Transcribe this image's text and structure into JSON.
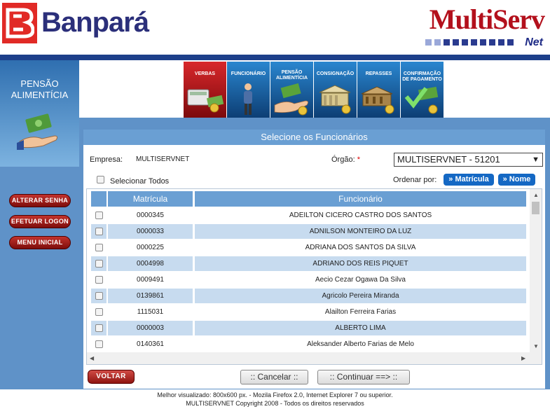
{
  "brand": {
    "bank": "Banpará",
    "app_title": "MultiServ",
    "app_suffix": "Net"
  },
  "left_panel": {
    "title_line1": "PENSÃO",
    "title_line2": "ALIMENTÍCIA",
    "buttons": [
      "ALTERAR SENHA",
      "EFETUAR LOGON",
      "MENU INICIAL"
    ]
  },
  "nav": [
    {
      "label": "VERBAS",
      "color": "#c0161b"
    },
    {
      "label": "FUNCIONÁRIO",
      "color": "#1f6aa8"
    },
    {
      "label": "PENSÃO ALIMENTÍCIA",
      "color": "#1f6aa8"
    },
    {
      "label": "CONSIGNAÇÃO",
      "color": "#1f6aa8"
    },
    {
      "label": "REPASSES",
      "color": "#1f6aa8"
    },
    {
      "label": "CONFIRMAÇÃO DE PAGAMENTO",
      "color": "#1f6aa8"
    }
  ],
  "panel": {
    "title": "Selecione os Funcionários",
    "empresa_label": "Empresa:",
    "empresa_value": "MULTISERVNET",
    "orgao_label": "Órgão:",
    "orgao_required": "*",
    "orgao_value": "MULTISERVNET - 51201",
    "select_all": "Selecionar Todos",
    "order_label": "Ordenar por:",
    "order_matricula": "» Matrícula",
    "order_nome": "» Nome"
  },
  "table": {
    "columns": [
      "Matrícula",
      "Funcionário"
    ],
    "rows": [
      [
        "0000345",
        "ADEILTON CICERO CASTRO DOS SANTOS"
      ],
      [
        "0000033",
        "ADNILSON MONTEIRO DA LUZ"
      ],
      [
        "0000225",
        "ADRIANA DOS SANTOS DA SILVA"
      ],
      [
        "0004998",
        "ADRIANO DOS REIS PIQUET"
      ],
      [
        "0009491",
        "Aecio Cezar Ogawa Da Silva"
      ],
      [
        "0139861",
        "Agricolo Pereira Miranda"
      ],
      [
        "1115031",
        "Alailton Ferreira Farias"
      ],
      [
        "0000003",
        "ALBERTO LIMA"
      ],
      [
        "0140361",
        "Aleksander Alberto Farias de Melo"
      ]
    ]
  },
  "actions": {
    "voltar": "VOLTAR",
    "cancelar": ":: Cancelar ::",
    "continuar": ":: Continuar ==> ::"
  },
  "footer": {
    "line1": "Melhor visualizado: 800x600 px. - Mozila Firefox 2.0, Internet Explorer 7 ou superior.",
    "line2": "MULTISERVNET Copyright 2008 - Todos os direitos reservados"
  },
  "colors": {
    "accent": "#1d3f8a",
    "panel_blue": "#5f92c8",
    "row_alt": "#c7dbef",
    "bank_red": "#e12a26"
  }
}
